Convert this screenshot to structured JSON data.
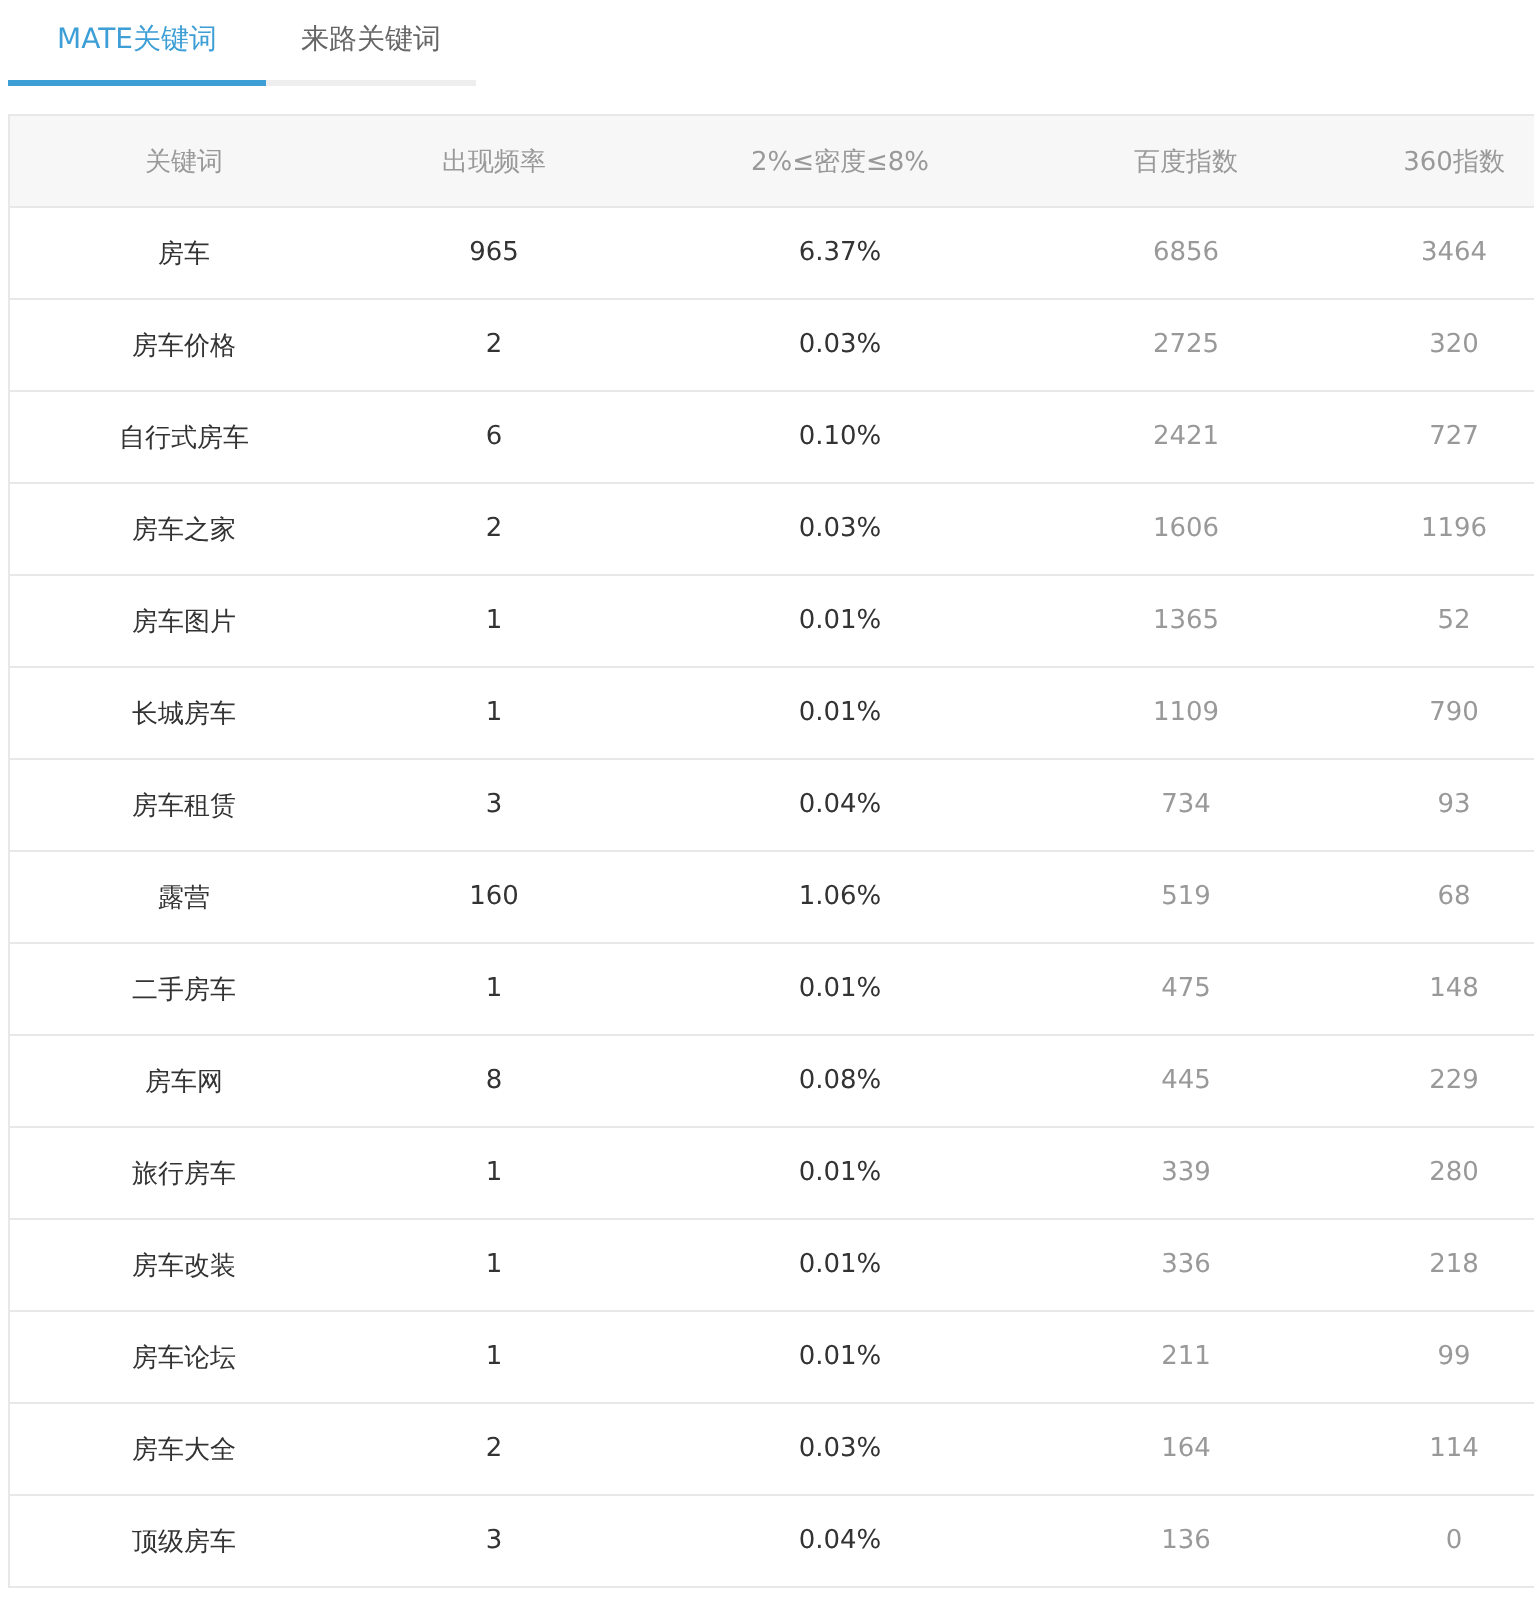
{
  "tabs": [
    {
      "label": "MATE关键词",
      "selected": true
    },
    {
      "label": "来路关键词",
      "selected": false
    }
  ],
  "table": {
    "columns": [
      "关键词",
      "出现频率",
      "2%≤密度≤8%",
      "百度指数",
      "360指数"
    ],
    "rows": [
      [
        "房车",
        "965",
        "6.37%",
        "6856",
        "3464"
      ],
      [
        "房车价格",
        "2",
        "0.03%",
        "2725",
        "320"
      ],
      [
        "自行式房车",
        "6",
        "0.10%",
        "2421",
        "727"
      ],
      [
        "房车之家",
        "2",
        "0.03%",
        "1606",
        "1196"
      ],
      [
        "房车图片",
        "1",
        "0.01%",
        "1365",
        "52"
      ],
      [
        "长城房车",
        "1",
        "0.01%",
        "1109",
        "790"
      ],
      [
        "房车租赁",
        "3",
        "0.04%",
        "734",
        "93"
      ],
      [
        "露营",
        "160",
        "1.06%",
        "519",
        "68"
      ],
      [
        "二手房车",
        "1",
        "0.01%",
        "475",
        "148"
      ],
      [
        "房车网",
        "8",
        "0.08%",
        "445",
        "229"
      ],
      [
        "旅行房车",
        "1",
        "0.01%",
        "339",
        "280"
      ],
      [
        "房车改装",
        "1",
        "0.01%",
        "336",
        "218"
      ],
      [
        "房车论坛",
        "1",
        "0.01%",
        "211",
        "99"
      ],
      [
        "房车大全",
        "2",
        "0.03%",
        "164",
        "114"
      ],
      [
        "顶级房车",
        "3",
        "0.04%",
        "136",
        "0"
      ]
    ]
  }
}
